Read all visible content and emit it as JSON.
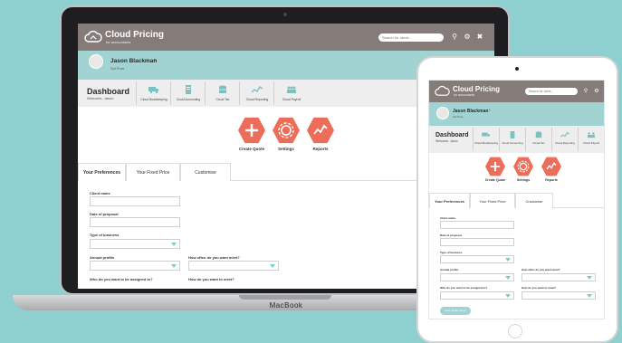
{
  "app": {
    "name": "Cloud Pricing",
    "tagline": "for accountants",
    "search_placeholder": "Search for client..."
  },
  "user": {
    "name": "Jason Blackman",
    "role": "Sol Pure"
  },
  "dashboard": {
    "title": "Dashboard",
    "welcome": "Welcome, Jason",
    "tiles": [
      {
        "label": "Cloud Bookkeeping",
        "icon": "truck-icon"
      },
      {
        "label": "Cloud Accounting",
        "icon": "document-icon"
      },
      {
        "label": "Cloud Tax",
        "icon": "database-icon"
      },
      {
        "label": "Cloud Reporting",
        "icon": "chart-line-icon"
      },
      {
        "label": "Cloud Payroll",
        "icon": "people-icon"
      }
    ]
  },
  "actions": [
    {
      "label": "Create Quote",
      "icon": "plus-icon"
    },
    {
      "label": "Settings",
      "icon": "gear-icon"
    },
    {
      "label": "Reports",
      "icon": "trend-icon"
    }
  ],
  "tabs": [
    "Your Preferences",
    "Your Fixed Price",
    "Customise"
  ],
  "form": {
    "client_name": "Client name",
    "date_of_proposal": "Date of proposal",
    "type_of_business": "Type of business",
    "annual_profits": "Annual profits",
    "meet_when": "How often do you want meet?",
    "assigned_to": "Who do you want to be assigned to?",
    "meet_how": "How do you want to meet?",
    "submit": "Save these prices"
  },
  "device": {
    "brand": "MacBook"
  },
  "colors": {
    "header": "#857c7a",
    "accent": "#a2d3d3",
    "action": "#ec6d5a",
    "background": "#8ecfcf"
  }
}
